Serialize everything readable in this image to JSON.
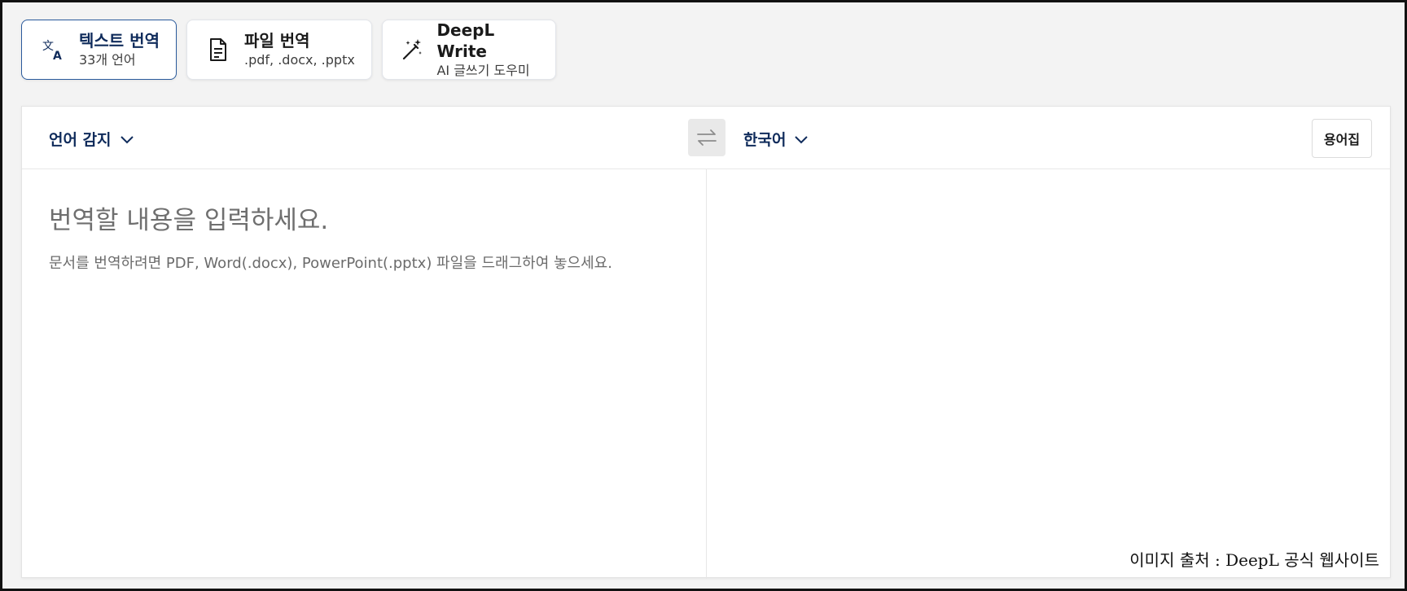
{
  "tabs": [
    {
      "title": "텍스트 번역",
      "subtitle": "33개 언어",
      "icon": "translate-icon",
      "active": true
    },
    {
      "title": "파일 번역",
      "subtitle": ".pdf, .docx, .pptx",
      "icon": "document-icon",
      "active": false
    },
    {
      "title": "DeepL Write",
      "subtitle": "AI 글쓰기 도우미",
      "icon": "magic-wand-icon",
      "active": false
    }
  ],
  "translator": {
    "source_language": "언어 감지",
    "target_language": "한국어",
    "glossary_label": "용어집",
    "source_placeholder": "번역할 내용을 입력하세요.",
    "source_hint": "문서를 번역하려면 PDF, Word(.docx), PowerPoint(.pptx) 파일을 드래그하여 놓으세요."
  },
  "caption": "이미지 출처 : DeepL 공식 웹사이트",
  "colors": {
    "accent": "#0f2b5b",
    "active_border": "#2a5a9c",
    "background": "#f3f3f3"
  }
}
